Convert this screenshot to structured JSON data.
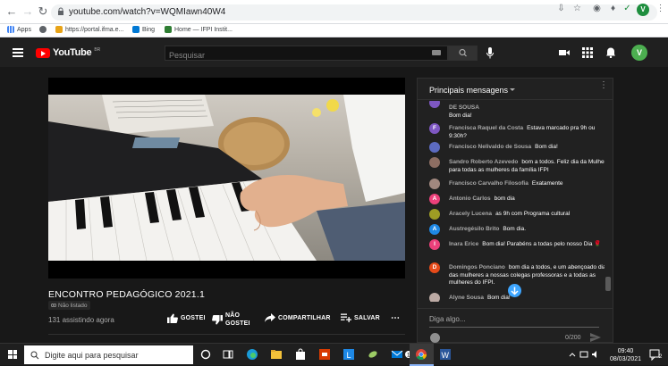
{
  "browser": {
    "url": "youtube.com/watch?v=WQMIawn40W4",
    "profile_initial": "V",
    "bookmarks": [
      {
        "label": "Apps",
        "color": "#4285f4"
      },
      {
        "label": "",
        "color": "#5f6368"
      },
      {
        "label": "https://portal.ifma.e...",
        "color": "#e8a317"
      },
      {
        "label": "Bing",
        "color": "#0078d4"
      },
      {
        "label": "Home — IFPI Instit...",
        "color": "#2e7d32"
      }
    ]
  },
  "youtube": {
    "logo_text": "YouTube",
    "logo_country": "BR",
    "search_placeholder": "Pesquisar",
    "user_initial": "V"
  },
  "video": {
    "title": "ENCONTRO PEDAGÓGICO 2021.1",
    "badge": "Não listado",
    "viewers": "131 assistindo agora",
    "like_label": "GOSTEI",
    "dislike_label_1": "NÃO",
    "dislike_label_2": "GOSTEI",
    "share_label": "COMPARTILHAR",
    "save_label": "SALVAR"
  },
  "chat": {
    "header_title": "Principais mensagens",
    "messages": [
      {
        "author": "DE SOUSA",
        "text": "Bom dia!",
        "initial": "",
        "color": "#7e57c2"
      },
      {
        "author": "Francisca Raquel da Costa",
        "text": "Estava marcado pra 9h ou 9:30h?",
        "initial": "F",
        "color": "#7e57c2"
      },
      {
        "author": "Francisco Nelivaldo de Sousa",
        "text": "Bom dia!",
        "initial": "",
        "color": "#5c6bc0"
      },
      {
        "author": "Sandro Roberto Azevedo",
        "text": "bom a todos. Feliz dia da Mulher para todas as mulheres da família IFPI",
        "initial": "",
        "color": "#8d6e63"
      },
      {
        "author": "Francisco Carvalho Filosofia",
        "text": "Exatamente",
        "initial": "",
        "color": "#a1887f"
      },
      {
        "author": "Antonio Carlos",
        "text": "bom dia",
        "initial": "A",
        "color": "#ec407a"
      },
      {
        "author": "Aracely Lucena",
        "text": "as 9h com Programa cultural",
        "initial": "",
        "color": "#9e9d24"
      },
      {
        "author": "Austregésilo Brito",
        "text": "Bom dia.",
        "initial": "A",
        "color": "#1e88e5"
      },
      {
        "author": "Inara Erice",
        "text": "Bom dia! Parabéns a todas pelo nosso Dia 🌹",
        "initial": "I",
        "color": "#ec407a"
      },
      {
        "author": "Domingos Ponciano",
        "text": "bom dia a todos, e um abençoado dia das mulheres a nossas colegas professoras e a todas as mulheres do IFPI.",
        "initial": "D",
        "color": "#e64a19"
      },
      {
        "author": "Alyne Sousa",
        "text": "Bom dia!",
        "initial": "",
        "color": "#bcaaa4"
      }
    ],
    "input_placeholder": "Diga algo...",
    "counter": "0/200"
  },
  "taskbar": {
    "search_placeholder": "Digite aqui para pesquisar",
    "time": "09:40",
    "date": "08/03/2021",
    "notification_count": "2"
  }
}
